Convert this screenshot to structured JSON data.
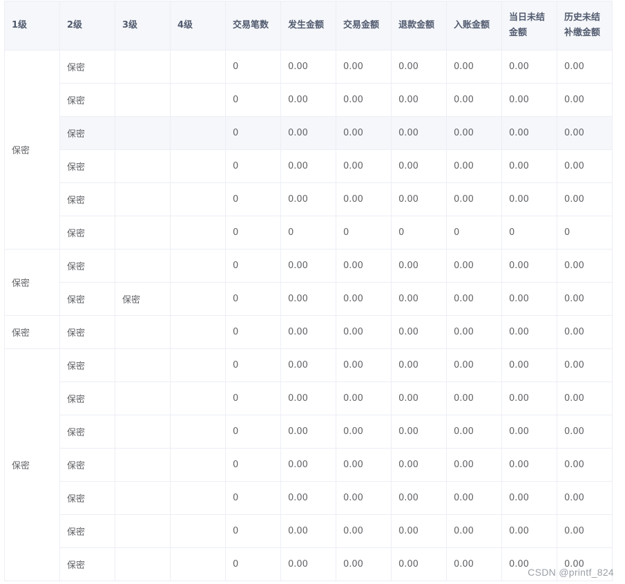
{
  "table": {
    "headers": [
      "1级",
      "2级",
      "3级",
      "4级",
      "交易笔数",
      "发生金额",
      "交易金额",
      "退款金额",
      "入账金额",
      "当日未结金额",
      "历史未结补缴金额"
    ],
    "groups": [
      {
        "level1": "保密",
        "rows": [
          {
            "l2": "保密",
            "l3": "",
            "values": [
              "0",
              "0.00",
              "0.00",
              "0.00",
              "0.00",
              "0.00",
              "0.00"
            ]
          },
          {
            "l2": "保密",
            "l3": "",
            "values": [
              "0",
              "0.00",
              "0.00",
              "0.00",
              "0.00",
              "0.00",
              "0.00"
            ]
          },
          {
            "l2": "保密",
            "l3": "",
            "values": [
              "0",
              "0.00",
              "0.00",
              "0.00",
              "0.00",
              "0.00",
              "0.00"
            ],
            "highlight": true
          },
          {
            "l2": "保密",
            "l3": "",
            "values": [
              "0",
              "0.00",
              "0.00",
              "0.00",
              "0.00",
              "0.00",
              "0.00"
            ]
          },
          {
            "l2": "保密",
            "l3": "",
            "values": [
              "0",
              "0.00",
              "0.00",
              "0.00",
              "0.00",
              "0.00",
              "0.00"
            ]
          },
          {
            "l2": "保密",
            "l3": "",
            "values": [
              "0",
              "0",
              "0",
              "0",
              "0",
              "0",
              "0"
            ]
          }
        ]
      },
      {
        "level1": "保密",
        "rows": [
          {
            "l2": "保密",
            "l3": "",
            "values": [
              "0",
              "0.00",
              "0.00",
              "0.00",
              "0.00",
              "0.00",
              "0.00"
            ]
          },
          {
            "l2": "保密",
            "l3": "保密",
            "values": [
              "0",
              "0.00",
              "0.00",
              "0.00",
              "0.00",
              "0.00",
              "0.00"
            ]
          }
        ]
      },
      {
        "level1": "保密",
        "rows": [
          {
            "l2": "保密",
            "l3": "",
            "values": [
              "0",
              "0.00",
              "0.00",
              "0.00",
              "0.00",
              "0.00",
              "0.00"
            ]
          }
        ]
      },
      {
        "level1": "保密",
        "rows": [
          {
            "l2": "保密",
            "l3": "",
            "values": [
              "0",
              "0.00",
              "0.00",
              "0.00",
              "0.00",
              "0.00",
              "0.00"
            ]
          },
          {
            "l2": "保密",
            "l3": "",
            "values": [
              "0",
              "0.00",
              "0.00",
              "0.00",
              "0.00",
              "0.00",
              "0.00"
            ]
          },
          {
            "l2": "保密",
            "l3": "",
            "values": [
              "0",
              "0.00",
              "0.00",
              "0.00",
              "0.00",
              "0.00",
              "0.00"
            ]
          },
          {
            "l2": "保密",
            "l3": "",
            "values": [
              "0",
              "0.00",
              "0.00",
              "0.00",
              "0.00",
              "0.00",
              "0.00"
            ]
          },
          {
            "l2": "保密",
            "l3": "",
            "values": [
              "0",
              "0.00",
              "0.00",
              "0.00",
              "0.00",
              "0.00",
              "0.00"
            ]
          },
          {
            "l2": "保密",
            "l3": "",
            "values": [
              "0",
              "0.00",
              "0.00",
              "0.00",
              "0.00",
              "0.00",
              "0.00"
            ]
          },
          {
            "l2": "保密",
            "l3": "",
            "values": [
              "0",
              "0.00",
              "0.00",
              "0.00",
              "0.00",
              "0.00",
              "0.00"
            ]
          }
        ]
      }
    ]
  },
  "watermark": "CSDN @printf_824",
  "colors": {
    "border": "#ebeef5",
    "header_bg": "#f5f7fa",
    "text": "#606266"
  }
}
